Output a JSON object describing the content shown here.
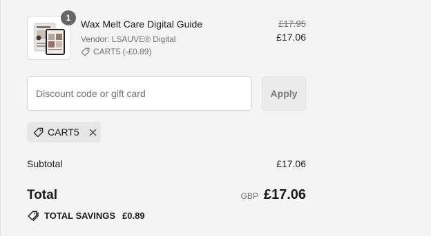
{
  "line_item": {
    "quantity": "1",
    "title": "Wax Melt Care Digital Guide",
    "vendor": "Vendor: LSAUVE® Digital",
    "discount": "CART5 (-£0.89)",
    "original_price": "£17.95",
    "price": "£17.06"
  },
  "discount_form": {
    "placeholder": "Discount code or gift card",
    "apply_label": "Apply"
  },
  "applied_code": {
    "code": "CART5"
  },
  "summary": {
    "subtotal_label": "Subtotal",
    "subtotal_value": "£17.06",
    "total_label": "Total",
    "currency": "GBP",
    "total_value": "£17.06",
    "savings_label": "TOTAL SAVINGS",
    "savings_value": "£0.89"
  },
  "icons": {
    "line_discount": "tag-icon",
    "chip": "tag-icon",
    "chip_remove": "close-icon",
    "savings": "tags-icon"
  },
  "colors": {
    "background": "#f4f4f4",
    "badge": "#666666",
    "muted_text": "#707070",
    "chip_background": "#e6e6e6"
  }
}
